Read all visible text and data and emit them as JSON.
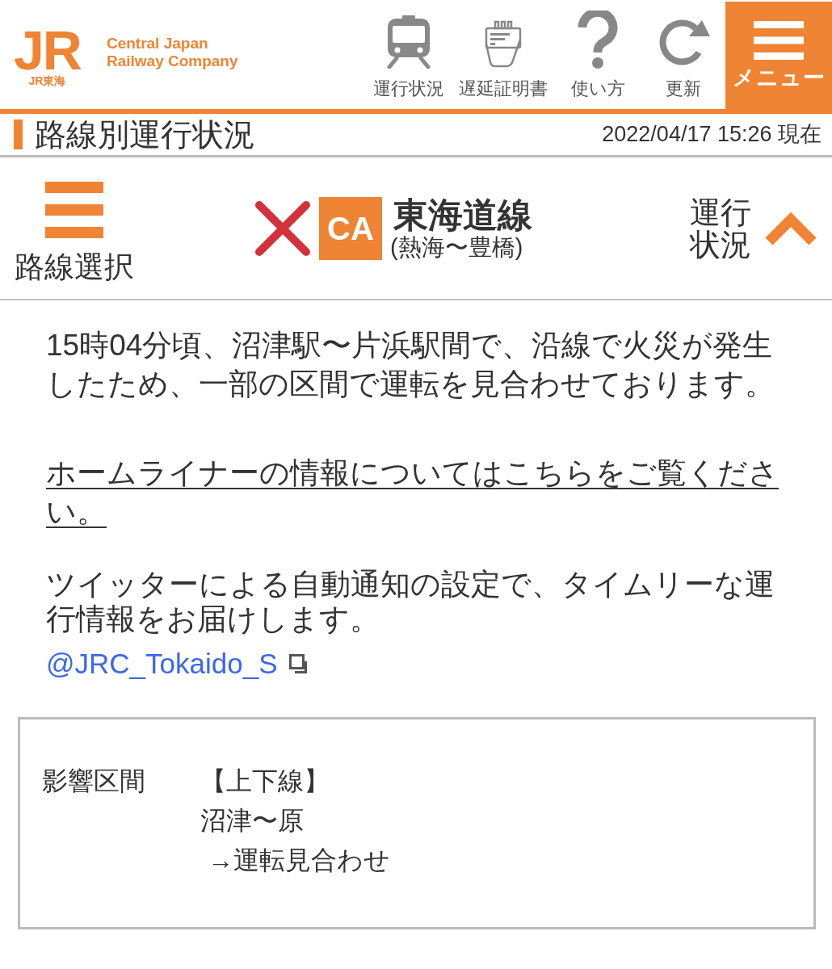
{
  "header": {
    "logo": {
      "mark": "JR",
      "sub": "JR東海",
      "company": "Central Japan Railway Company"
    },
    "nav": [
      {
        "kind": "train",
        "label": "運行状況"
      },
      {
        "kind": "certificate",
        "label": "遅延証明書"
      },
      {
        "kind": "help",
        "label": "使い方"
      },
      {
        "kind": "refresh",
        "label": "更新"
      }
    ],
    "menu_button": {
      "label": "メニュー"
    }
  },
  "title_bar": {
    "title": "路線別運行状況",
    "timestamp": "2022/04/17 15:26 現在"
  },
  "line_header": {
    "line_select": {
      "label": "路線選択"
    },
    "suspended": true,
    "line_code": "CA",
    "line_name": "東海道線",
    "section": "(熱海〜豊橋)",
    "status_toggle": {
      "label": "運行状況",
      "expanded": true
    }
  },
  "notice": {
    "message": "15時04分頃、沼津駅〜片浜駅間で、沿線で火災が発生したため、一部の区間で運転を見合わせております。",
    "link": "ホームライナーの情報についてはこちらをご覧ください。",
    "twitter_text": "ツイッターによる自動通知の設定で、タイムリーな運行情報をお届けします。",
    "twitter_handle": "@JRC_Tokaido_S"
  },
  "affected": {
    "label": "影響区間",
    "lines": [
      "【上下線】",
      "沼津〜原",
      " →運転見合わせ"
    ]
  }
}
